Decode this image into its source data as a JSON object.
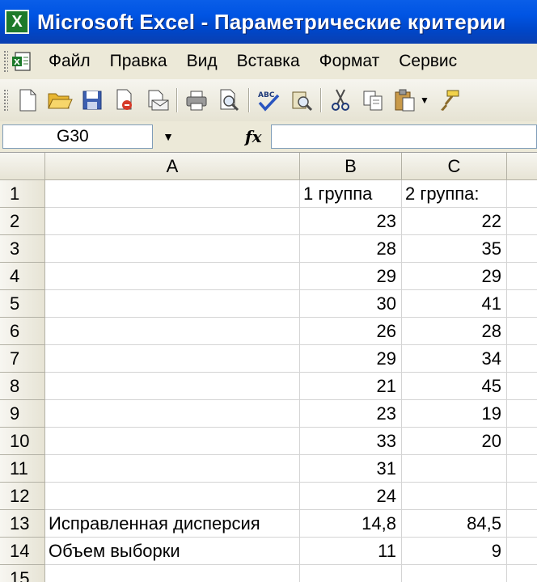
{
  "window": {
    "title": "Microsoft Excel - Параметрические критерии",
    "app_icon": "excel-icon"
  },
  "menu": [
    "Файл",
    "Правка",
    "Вид",
    "Вставка",
    "Формат",
    "Сервис"
  ],
  "toolbar": {
    "icons": [
      "new-document-icon",
      "open-folder-icon",
      "save-icon",
      "permission-icon",
      "email-icon",
      "print-icon",
      "print-preview-icon",
      "spelling-icon",
      "research-icon",
      "cut-icon",
      "copy-icon",
      "paste-icon",
      "format-painter-icon"
    ]
  },
  "formula_bar": {
    "name_box": "G30",
    "fx_label": "fx",
    "formula": ""
  },
  "sheet": {
    "columns": [
      "A",
      "B",
      "C"
    ],
    "rows": [
      {
        "num": "1",
        "a": "",
        "b": "1 группа",
        "c": "2 группа:"
      },
      {
        "num": "2",
        "a": "",
        "b": "23",
        "c": "22"
      },
      {
        "num": "3",
        "a": "",
        "b": "28",
        "c": "35"
      },
      {
        "num": "4",
        "a": "",
        "b": "29",
        "c": "29"
      },
      {
        "num": "5",
        "a": "",
        "b": "30",
        "c": "41"
      },
      {
        "num": "6",
        "a": "",
        "b": "26",
        "c": "28"
      },
      {
        "num": "7",
        "a": "",
        "b": "29",
        "c": "34"
      },
      {
        "num": "8",
        "a": "",
        "b": "21",
        "c": "45"
      },
      {
        "num": "9",
        "a": "",
        "b": "23",
        "c": "19"
      },
      {
        "num": "10",
        "a": "",
        "b": "33",
        "c": "20"
      },
      {
        "num": "11",
        "a": "",
        "b": "31",
        "c": ""
      },
      {
        "num": "12",
        "a": "",
        "b": "24",
        "c": ""
      },
      {
        "num": "13",
        "a": "Исправленная дисперсия",
        "b": "14,8",
        "c": "84,5"
      },
      {
        "num": "14",
        "a": "Объем выборки",
        "b": "11",
        "c": "9"
      },
      {
        "num": "15",
        "a": "",
        "b": "",
        "c": ""
      }
    ]
  },
  "colors": {
    "title_bar": "#0054e3",
    "chrome": "#ece9d8",
    "grid_line": "#d4d4d4"
  }
}
